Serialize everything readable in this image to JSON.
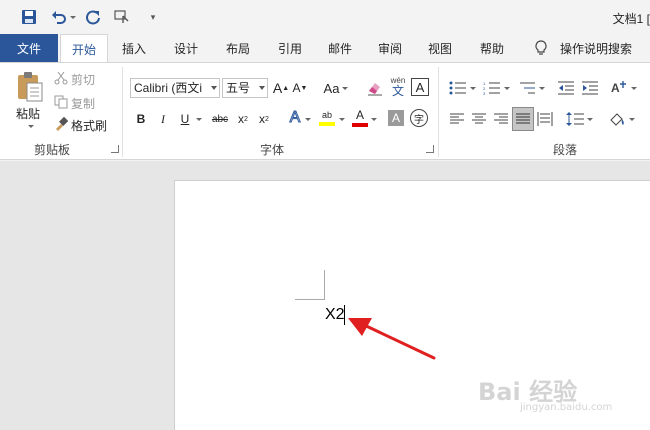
{
  "titlebar": {
    "doc_title": "文档1 [",
    "qat_more": "▾"
  },
  "tabs": [
    "文件",
    "开始",
    "插入",
    "设计",
    "布局",
    "引用",
    "邮件",
    "审阅",
    "视图",
    "帮助"
  ],
  "tell_me": "操作说明搜索",
  "clipboard": {
    "paste": "粘贴",
    "cut": "剪切",
    "copy": "复制",
    "format_painter": "格式刷",
    "group_label": "剪贴板"
  },
  "font": {
    "font_name": "Calibri (西文i",
    "font_size": "五号",
    "grow": "A",
    "shrink": "A",
    "change_case": "Aa",
    "phonetic_top": "wén",
    "phonetic_bottom": "文",
    "border_char": "A",
    "bold": "B",
    "italic": "I",
    "underline": "U",
    "strikethrough": "abc",
    "subscript": "x",
    "superscript": "x",
    "sub_index": "2",
    "sup_index": "2",
    "text_effects": "A",
    "highlight": "ab",
    "font_color": "A",
    "char_shading": "A",
    "enclose": "字",
    "group_label": "字体"
  },
  "paragraph": {
    "group_label": "段落"
  },
  "document": {
    "text": "X2"
  },
  "watermark": {
    "main": "Bai 经验",
    "sub": "jingyan.baidu.com"
  },
  "colors": {
    "file_tab": "#2b579a",
    "accent": "#2b579a",
    "arrow": "#e02020",
    "highlight": "#ffff00",
    "font_red": "#e00000"
  }
}
